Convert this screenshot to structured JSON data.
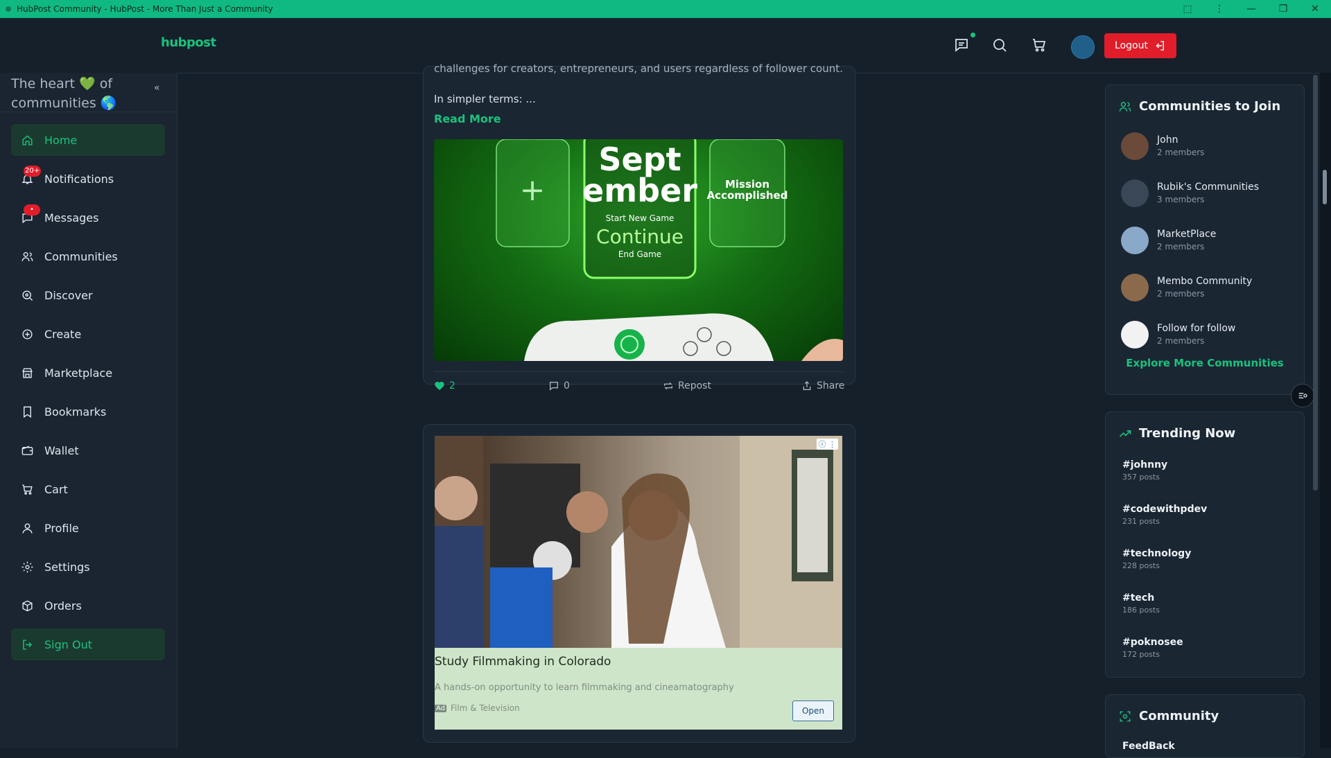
{
  "window": {
    "title": "HubPost Community - HubPost - More Than Just a Community",
    "controls": [
      "⬚",
      "⋮",
      "—",
      "❐",
      "✕"
    ]
  },
  "topnav": {
    "logo": "hubpost",
    "logout_label": "Logout",
    "icons": [
      "messages-icon",
      "search-icon",
      "cart-icon"
    ]
  },
  "sidebar": {
    "tagline_a": "The heart ",
    "tagline_heart": "💚",
    "tagline_b": " of communities ",
    "tagline_globe": "🌎",
    "collapse": "«",
    "items": [
      {
        "label": "Home",
        "icon": "home-icon",
        "active": true
      },
      {
        "label": "Notifications",
        "icon": "bell-icon",
        "badge": "20+"
      },
      {
        "label": "Messages",
        "icon": "message-icon",
        "badge": "•"
      },
      {
        "label": "Communities",
        "icon": "users-icon"
      },
      {
        "label": "Discover",
        "icon": "discover-icon"
      },
      {
        "label": "Create",
        "icon": "plus-circle-icon"
      },
      {
        "label": "Marketplace",
        "icon": "store-icon"
      },
      {
        "label": "Bookmarks",
        "icon": "bookmark-icon"
      },
      {
        "label": "Wallet",
        "icon": "wallet-icon"
      },
      {
        "label": "Cart",
        "icon": "cart-icon"
      },
      {
        "label": "Profile",
        "icon": "user-icon"
      },
      {
        "label": "Settings",
        "icon": "gear-icon"
      },
      {
        "label": "Orders",
        "icon": "box-icon"
      },
      {
        "label": "Sign Out",
        "icon": "sign-out-icon"
      }
    ]
  },
  "post": {
    "cut_text": "challenges for creators, entrepreneurs, and users regardless of follower count.",
    "text": "In simpler terms:  ...",
    "read_more": "Read More",
    "image": {
      "big1": "Sept",
      "big2": "ember",
      "start": "Start New Game",
      "continue": "Continue",
      "end": "End Game",
      "mission1": "Mission",
      "mission2": "Accomplished",
      "plus": "+"
    },
    "likes": "2",
    "comments": "0",
    "repost": "Repost",
    "share": "Share"
  },
  "ad": {
    "title": "Study Filmmaking in Colorado",
    "description": "A hands-on opportunity to learn filmmaking and cineamatography",
    "ad_label": "Ad",
    "category": "Film & Television",
    "open": "Open",
    "info": "ⓘ ⋮"
  },
  "communities": {
    "title": "Communities to Join",
    "items": [
      {
        "name": "John",
        "members": "2 members",
        "color": "#6b4a3a"
      },
      {
        "name": "Rubik's Communities",
        "members": "3 members",
        "color": "#3a4756"
      },
      {
        "name": "MarketPlace",
        "members": "2 members",
        "color": "#8aa8c8"
      },
      {
        "name": "Membo Community",
        "members": "2 members",
        "color": "#8a6a4a"
      },
      {
        "name": "Follow for follow",
        "members": "2 members",
        "color": "#f2f2f2"
      }
    ],
    "explore": "Explore More Communities"
  },
  "trending": {
    "title": "Trending Now",
    "items": [
      {
        "tag": "#johnny",
        "count": "357 posts"
      },
      {
        "tag": "#codewithpdev",
        "count": "231 posts"
      },
      {
        "tag": "#technology",
        "count": "228 posts"
      },
      {
        "tag": "#tech",
        "count": "186 posts"
      },
      {
        "tag": "#poknosee",
        "count": "172 posts"
      }
    ]
  },
  "community_card": {
    "title": "Community",
    "cut": "FeedBack"
  },
  "colors": {
    "accent": "#19c37d",
    "danger": "#e11d2a",
    "bg": "#16202b"
  }
}
